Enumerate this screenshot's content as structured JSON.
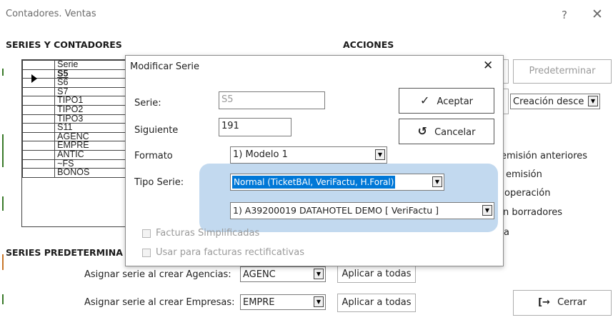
{
  "window": {
    "title": "Contadores. Ventas",
    "help_icon": "?",
    "close_icon": "✕"
  },
  "sections": {
    "series": "SERIES Y CONTADORES",
    "acciones": "ACCIONES",
    "predeterminadas": "SERIES PREDETERMINA"
  },
  "grid": {
    "header": "Serie",
    "rows": [
      "S5",
      "S6",
      "S7",
      "TIPO1",
      "TIPO2",
      "TIPO3",
      "S11",
      "AGENC",
      "EMPRE",
      "ANTIC",
      "~FS",
      "BONOS"
    ]
  },
  "actions": {
    "predeterminar": "Predeterminar",
    "creacion_combo": "Creación desce",
    "item1": "emisión anteriores",
    "item2": "emisión",
    "item3": "operación",
    "item4": "n borradores",
    "item5": "a"
  },
  "assign": {
    "agencias_label": "Asignar serie al crear Agencias:",
    "agencias_value": "AGENC",
    "empresas_label": "Asignar serie al crear Empresas:",
    "empresas_value": "EMPRE",
    "aplicar": "Aplicar a todas",
    "cerrar": "Cerrar"
  },
  "dialog": {
    "title": "Modificar Serie",
    "close": "✕",
    "serie_label": "Serie:",
    "serie_value": "S5",
    "siguiente_label": "Siguiente",
    "siguiente_value": "191",
    "formato_label": "Formato",
    "formato_value": "1) Modelo 1",
    "tipo_label": "Tipo Serie:",
    "tipo_value": "Normal (TicketBAI, VeriFactu, H.Foral)",
    "empresa_value": "1) A39200019 DATAHOTEL DEMO [ VeriFactu ]",
    "aceptar": "Aceptar",
    "cancelar": "Cancelar",
    "chk_simplificadas": "Facturas Simplificadas",
    "chk_rectificativas": "Usar para facturas rectificativas"
  }
}
